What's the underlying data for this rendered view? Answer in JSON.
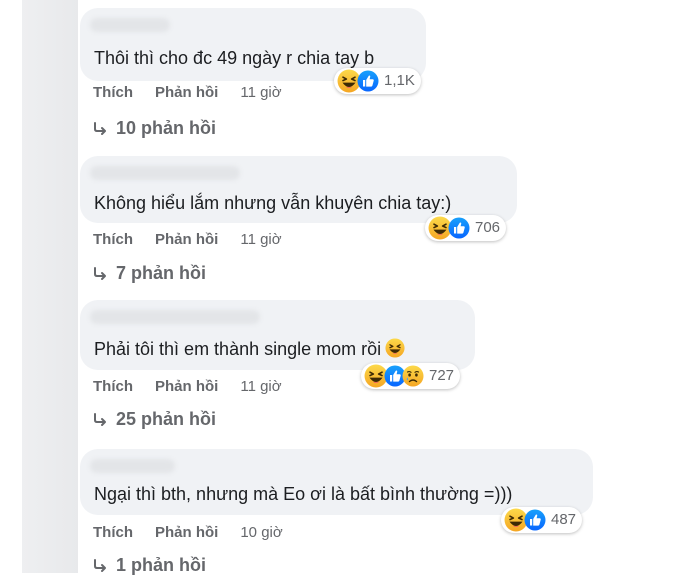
{
  "comments": [
    {
      "text": "Thôi thì cho đc 49 ngày r chia tay b",
      "inline_emoji": "",
      "reaction_icons": [
        "haha-icon",
        "like-icon"
      ],
      "reaction_count": "1,1K",
      "actions": {
        "like": "Thích",
        "reply": "Phản hồi",
        "time": "11 giờ"
      },
      "replies": "10 phản hồi"
    },
    {
      "text": "Không hiểu lắm nhưng vẫn khuyên chia tay:)",
      "inline_emoji": "",
      "reaction_icons": [
        "haha-icon",
        "like-icon"
      ],
      "reaction_count": "706",
      "actions": {
        "like": "Thích",
        "reply": "Phản hồi",
        "time": "11 giờ"
      },
      "replies": "7 phản hồi"
    },
    {
      "text": "Phải tôi thì em thành single mom rồi",
      "inline_emoji": "laughing-emoji",
      "reaction_icons": [
        "haha-icon",
        "like-icon",
        "sad-icon"
      ],
      "reaction_count": "727",
      "actions": {
        "like": "Thích",
        "reply": "Phản hồi",
        "time": "11 giờ"
      },
      "replies": "25 phản hồi"
    },
    {
      "text": "Ngại thì bth, nhưng mà Eo ơi là bất bình thường =)))",
      "inline_emoji": "",
      "reaction_icons": [
        "haha-icon",
        "like-icon"
      ],
      "reaction_count": "487",
      "actions": {
        "like": "Thích",
        "reply": "Phản hồi",
        "time": "10 giờ"
      },
      "replies": "1 phản hồi"
    }
  ],
  "colors": {
    "bubble_bg": "#f0f2f5",
    "text": "#1c1e21",
    "secondary_text": "#65676b",
    "like_blue": "#1877f2",
    "haha_yellow": "#f7b928"
  }
}
